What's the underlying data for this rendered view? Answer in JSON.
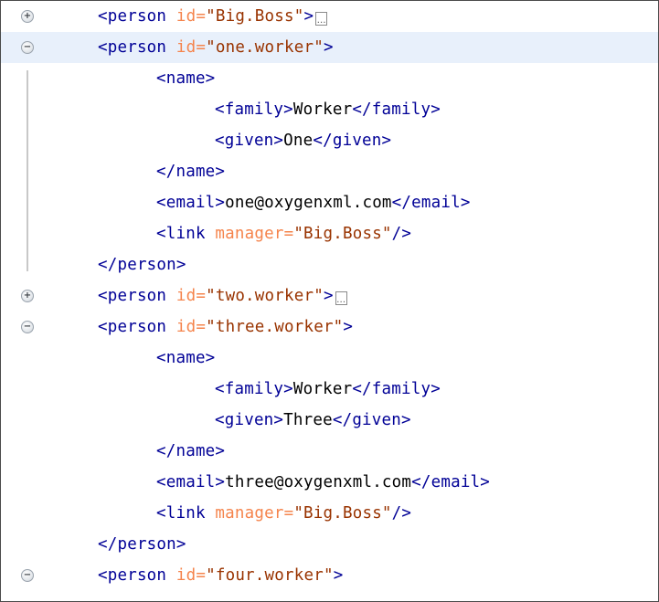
{
  "fold_expanded_glyph": "−",
  "fold_collapsed_glyph": "+",
  "ellipsis_glyph": "…",
  "lines": [
    {
      "indent": 0,
      "fold": "collapsed",
      "folded": true,
      "open": "<person",
      "attr": " id=",
      "value": "\"Big.Boss\"",
      "close": ">",
      "text": "",
      "end": ""
    },
    {
      "indent": 0,
      "fold": "expanded",
      "current": true,
      "open": "<person",
      "attr": " id=",
      "value": "\"one.worker\"",
      "close": ">",
      "text": "",
      "end": ""
    },
    {
      "indent": 1,
      "open": "<name>",
      "attr": "",
      "value": "",
      "close": "",
      "text": "",
      "end": ""
    },
    {
      "indent": 2,
      "open": "<family>",
      "attr": "",
      "value": "",
      "close": "",
      "text": "Worker",
      "end": "</family>"
    },
    {
      "indent": 2,
      "open": "<given>",
      "attr": "",
      "value": "",
      "close": "",
      "text": "One",
      "end": "</given>"
    },
    {
      "indent": 1,
      "open": "</name>",
      "attr": "",
      "value": "",
      "close": "",
      "text": "",
      "end": ""
    },
    {
      "indent": 1,
      "open": "<email>",
      "attr": "",
      "value": "",
      "close": "",
      "text": "one@oxygenxml.com",
      "end": "</email>"
    },
    {
      "indent": 1,
      "open": "<link",
      "attr": " manager=",
      "value": "\"Big.Boss\"",
      "close": "/>",
      "text": "",
      "end": ""
    },
    {
      "indent": 0,
      "open": "</person>",
      "attr": "",
      "value": "",
      "close": "",
      "text": "",
      "end": ""
    },
    {
      "indent": 0,
      "fold": "collapsed",
      "folded": true,
      "open": "<person",
      "attr": " id=",
      "value": "\"two.worker\"",
      "close": ">",
      "text": "",
      "end": ""
    },
    {
      "indent": 0,
      "fold": "expanded",
      "open": "<person",
      "attr": " id=",
      "value": "\"three.worker\"",
      "close": ">",
      "text": "",
      "end": ""
    },
    {
      "indent": 1,
      "open": "<name>",
      "attr": "",
      "value": "",
      "close": "",
      "text": "",
      "end": ""
    },
    {
      "indent": 2,
      "open": "<family>",
      "attr": "",
      "value": "",
      "close": "",
      "text": "Worker",
      "end": "</family>"
    },
    {
      "indent": 2,
      "open": "<given>",
      "attr": "",
      "value": "",
      "close": "",
      "text": "Three",
      "end": "</given>"
    },
    {
      "indent": 1,
      "open": "</name>",
      "attr": "",
      "value": "",
      "close": "",
      "text": "",
      "end": ""
    },
    {
      "indent": 1,
      "open": "<email>",
      "attr": "",
      "value": "",
      "close": "",
      "text": "three@oxygenxml.com",
      "end": "</email>"
    },
    {
      "indent": 1,
      "open": "<link",
      "attr": " manager=",
      "value": "\"Big.Boss\"",
      "close": "/>",
      "text": "",
      "end": ""
    },
    {
      "indent": 0,
      "open": "</person>",
      "attr": "",
      "value": "",
      "close": "",
      "text": "",
      "end": ""
    },
    {
      "indent": 0,
      "fold": "expanded",
      "open": "<person",
      "attr": " id=",
      "value": "\"four.worker\"",
      "close": ">",
      "text": "",
      "end": ""
    }
  ]
}
